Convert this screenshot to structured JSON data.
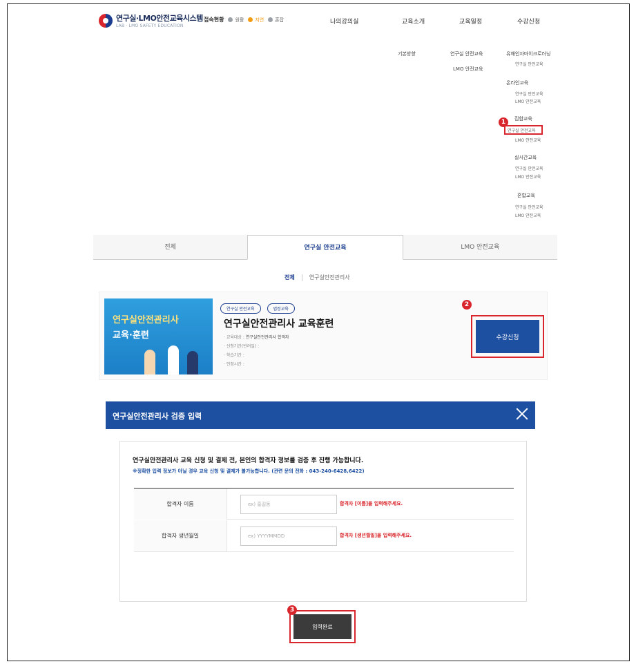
{
  "header": {
    "logo_title": "연구실·LMO안전교육시스템",
    "logo_sub": "LAB · LMO SAFETY EDUCATION",
    "status_label": "접속현황",
    "status_items": [
      {
        "label": "원활",
        "color": "#9aa0a6"
      },
      {
        "label": "지연",
        "color": "#f39c12"
      },
      {
        "label": "혼잡",
        "color": "#9aa0a6"
      }
    ],
    "nav": [
      "나의강의실",
      "교육소개",
      "교육일정",
      "수강신청"
    ]
  },
  "dropdown": {
    "col1": [
      "기본방향"
    ],
    "col2": [
      "연구실 안전교육",
      "LMO 안전교육"
    ],
    "col3": [
      {
        "title": "유해인자마이크로러닝",
        "items": [
          "연구실 안전교육"
        ]
      },
      {
        "title": "온라인교육",
        "items": [
          "연구실 안전교육",
          "LMO 안전교육"
        ]
      },
      {
        "title": "집합교육",
        "items": [
          "연구실 안전교육",
          "LMO 안전교육"
        ]
      },
      {
        "title": "실시간교육",
        "items": [
          "연구실 안전교육",
          "LMO 안전교육"
        ]
      },
      {
        "title": "혼합교육",
        "items": [
          "연구실 안전교육",
          "LMO 안전교육"
        ]
      }
    ]
  },
  "tabs": [
    "전체",
    "연구실 안전교육",
    "LMO 안전교육"
  ],
  "subtabs": [
    "전체",
    "연구실안전관리사"
  ],
  "course": {
    "thumb_line1": "연구실안전관리사",
    "thumb_line2": "교육·훈련",
    "chips": [
      "연구실 안전교육",
      "법정교육"
    ],
    "title": "연구실안전관리사 교육훈련",
    "meta": [
      {
        "label": "교육대상",
        "value": "연구실안전관리사 합격자"
      },
      {
        "label": "신청기간(반려일)",
        "value": ""
      },
      {
        "label": "학습기간",
        "value": ""
      },
      {
        "label": "인정시간",
        "value": ""
      }
    ],
    "apply_label": "수강신청"
  },
  "modal": {
    "title": "연구실안전관리사 검증 입력",
    "notice": "연구실안전관리사 교육 신청 및 결제 전, 본인의 합격자 정보를 검증 후 진행 가능합니다.",
    "notice_sub": "※정확한 입력 정보가 아닐 경우 교육 신청 및 결제가 불가능합니다. (관련 문의 전화 : 043-240-6428,6422)",
    "fields": [
      {
        "label": "합격자 이름",
        "placeholder": "ex) 홍길동",
        "hint": "합격자 [이름]을 입력해주세요."
      },
      {
        "label": "합격자 생년월일",
        "placeholder": "ex) YYYYMMDD",
        "hint": "합격자 [생년월일]을 입력해주세요."
      }
    ],
    "submit_label": "입력완료"
  },
  "badges": [
    "1",
    "2",
    "3"
  ],
  "colors": {
    "brand_blue": "#1e50a2",
    "highlight_red": "#d9262c"
  }
}
